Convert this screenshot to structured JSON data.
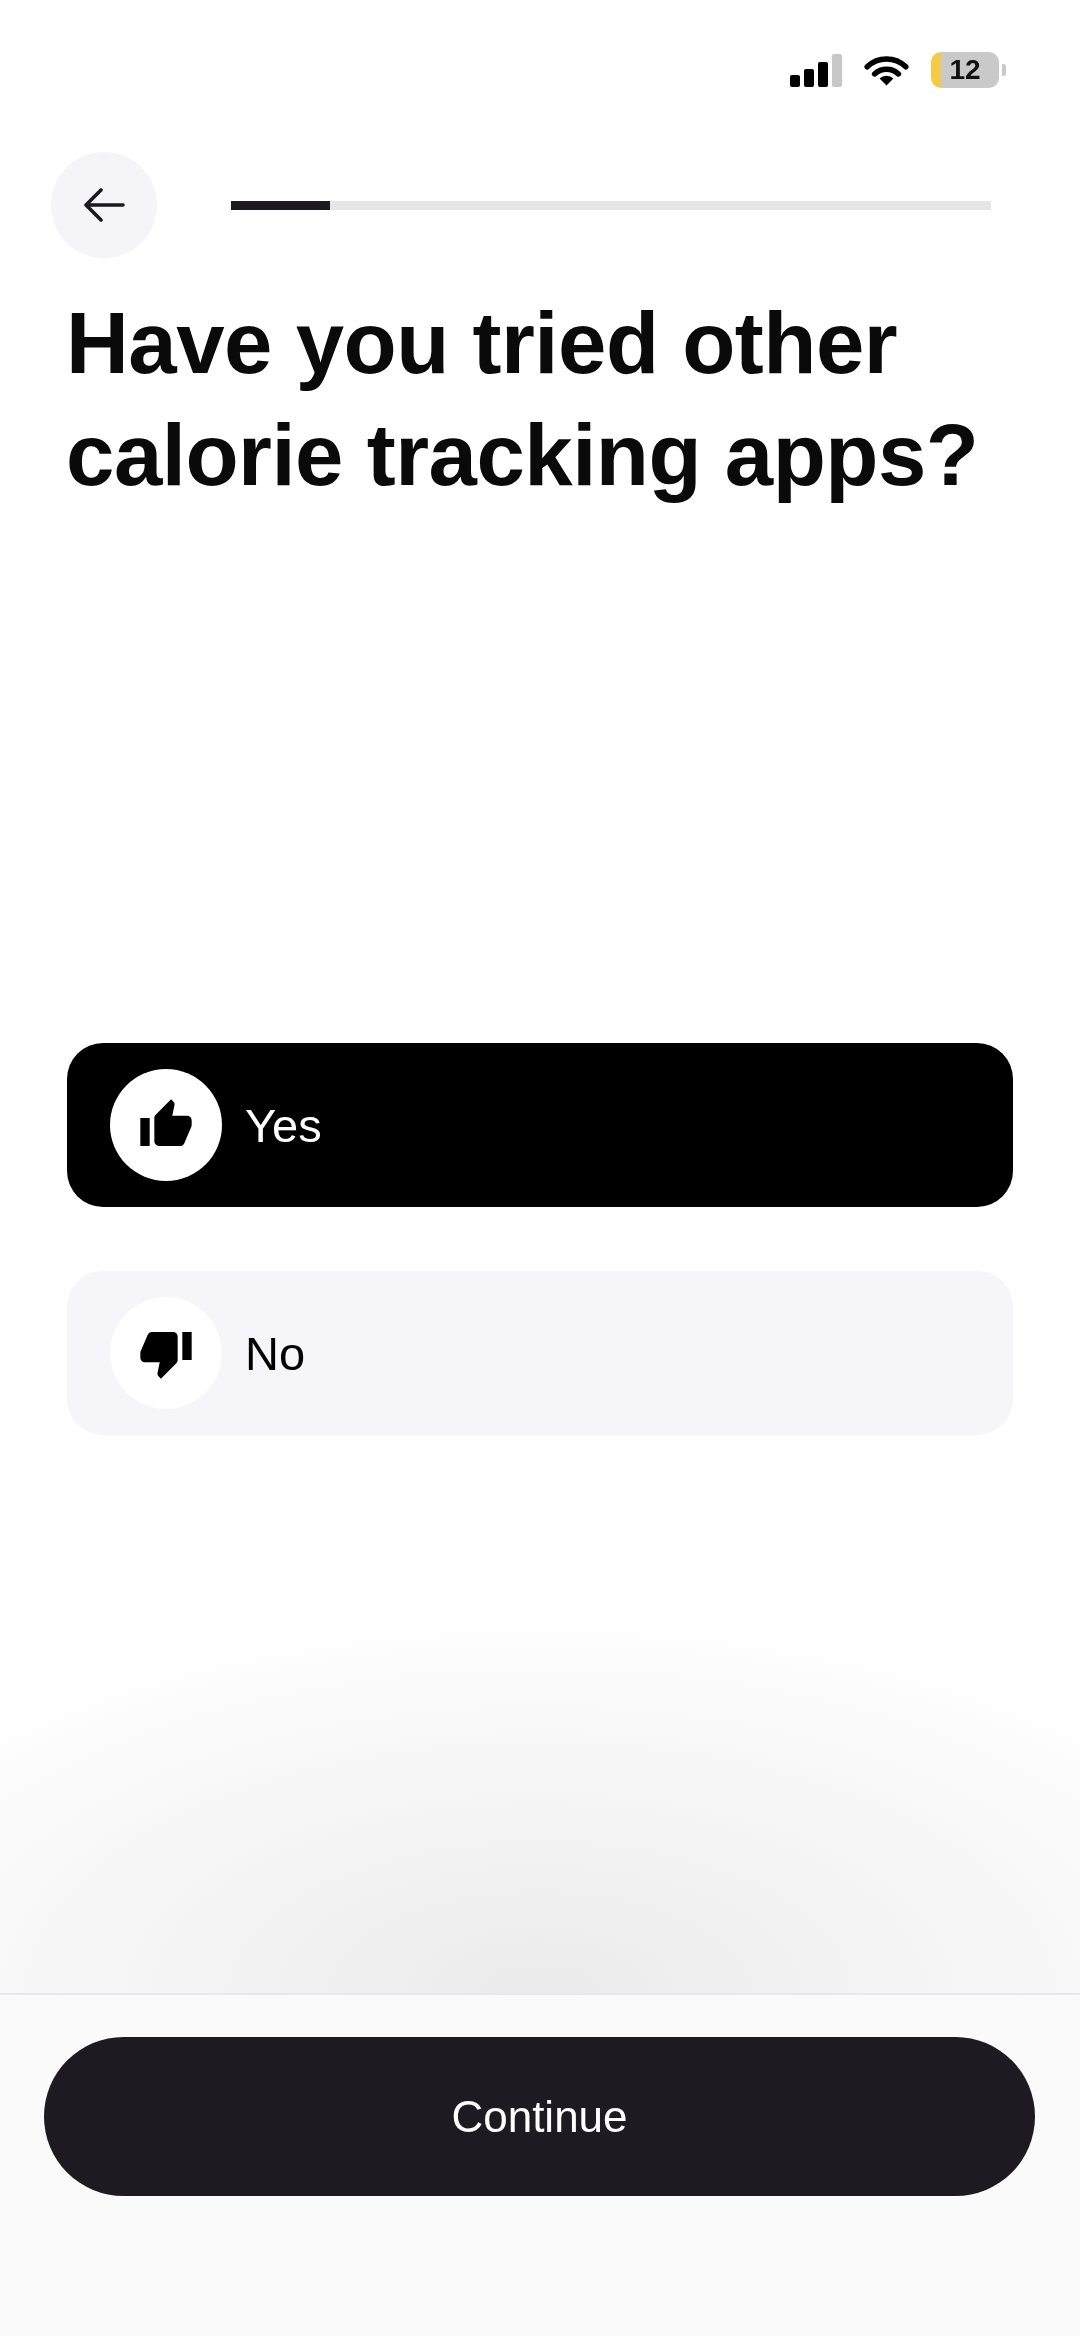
{
  "status_bar": {
    "battery": "12"
  },
  "progress": {
    "level": 0.13
  },
  "question": {
    "title": "Have you tried other calorie tracking apps?"
  },
  "options": [
    {
      "label": "Yes",
      "selected": true
    },
    {
      "label": "No",
      "selected": false
    }
  ],
  "continue_button": {
    "label": "Continue"
  }
}
